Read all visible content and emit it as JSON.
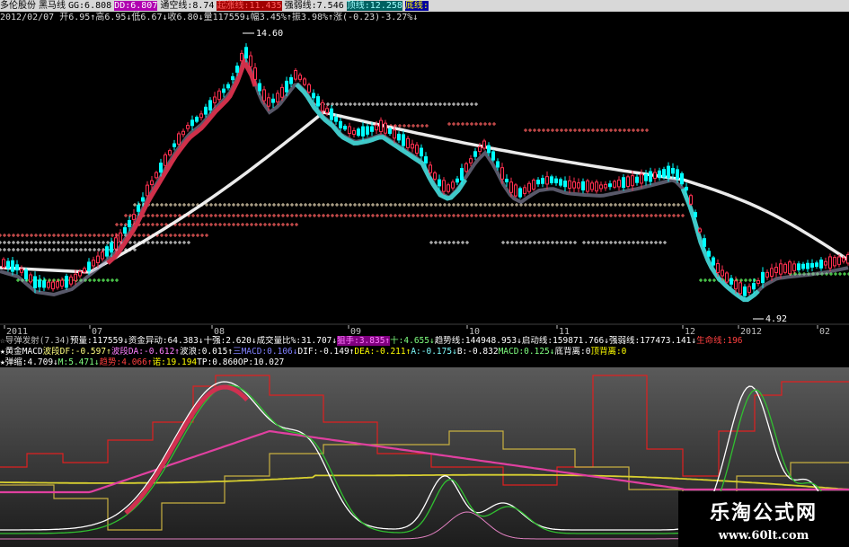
{
  "header": {
    "row1": [
      {
        "text": "多伦股份",
        "color": "#000000"
      },
      {
        "text": "黑马线",
        "color": "#000000"
      },
      {
        "text": "GG:6.808",
        "color": "#000000"
      },
      {
        "text": "DD:6.807",
        "color": "#ffffff",
        "bg": "#b000b0"
      },
      {
        "text": "通空线:8.74",
        "color": "#000000"
      },
      {
        "text": "起涨线:11.435",
        "color": "#ff6060",
        "bg": "#a00000"
      },
      {
        "text": "强弱线:7.546",
        "color": "#000000"
      },
      {
        "text": "顶线:12.258",
        "color": "#a0ffff",
        "bg": "#006060"
      },
      {
        "text": "底线:",
        "color": "#ffff00",
        "bg": "#0000a0"
      }
    ],
    "row2": "2012/02/07 开6.95↑高6.95↓低6.67↓收6.80↓量117559↓幅3.45%↑振3.98%↑涨(-0.23)-3.27%↓"
  },
  "price_labels": {
    "high": "14.60",
    "low": "4.92"
  },
  "x_axis": [
    {
      "label": "2011",
      "color": "#c0c0c0"
    },
    {
      "label": "07",
      "color": "#c0c0c0"
    },
    {
      "label": "08",
      "color": "#c0c0c0"
    },
    {
      "label": "09",
      "color": "#c0c0c0"
    },
    {
      "label": "10",
      "color": "#c0c0c0"
    },
    {
      "label": "11",
      "color": "#c0c0c0"
    },
    {
      "label": "12",
      "color": "#c0c0c0"
    },
    {
      "label": "2012",
      "color": "#c0c0c0"
    },
    {
      "label": "02",
      "color": "#c0c0c0"
    }
  ],
  "indicators": {
    "line1": [
      {
        "text": "☆导弹发射(7.34)",
        "color": "#c0c0c0"
      },
      {
        "text": "预量:117559↓",
        "color": "#ffffff"
      },
      {
        "text": "资金异动:64.383↓",
        "color": "#ffffff"
      },
      {
        "text": "十强:2.620↓",
        "color": "#ffffff"
      },
      {
        "text": "成交量比%:31.707↓",
        "color": "#ffffff"
      },
      {
        "text": "狙手:3.835↑",
        "color": "#ff80ff",
        "bg": "#800080"
      },
      {
        "text": "十:4.655↓",
        "color": "#80ff80"
      },
      {
        "text": "趋势线:144948.953↓",
        "color": "#ffffff"
      },
      {
        "text": "启动线:159871.766↓",
        "color": "#ffffff"
      },
      {
        "text": "强弱线:177473.141↓",
        "color": "#ffffff"
      },
      {
        "text": "生命线:196",
        "color": "#ff4040"
      }
    ],
    "line2": [
      {
        "text": "★黄金MACD",
        "color": "#ffffff"
      },
      {
        "text": "波段DF:-0.597↑",
        "color": "#ffff80"
      },
      {
        "text": "波段DA:-0.612↑",
        "color": "#ff80ff"
      },
      {
        "text": "波浪:0.015↑",
        "color": "#ffffff"
      },
      {
        "text": "三MACD:0.106↓",
        "color": "#8080ff"
      },
      {
        "text": "DIF:-0.149↑",
        "color": "#ffffff"
      },
      {
        "text": "DEA:-0.211↑",
        "color": "#ffff00"
      },
      {
        "text": "A:-0.175↓",
        "color": "#80ffff"
      },
      {
        "text": "B:-0.832",
        "color": "#ffffff"
      },
      {
        "text": "MACD:0.125↓",
        "color": "#80ff80"
      },
      {
        "text": "底背离:0",
        "color": "#ffffff"
      },
      {
        "text": "顶背离:0",
        "color": "#ffff00"
      }
    ],
    "line3": [
      {
        "text": "★弹",
        "color": "#ffffff"
      },
      {
        "text": "缩:4.709↓",
        "color": "#ffffff"
      },
      {
        "text": "M:5.471↓",
        "color": "#80ff80"
      },
      {
        "text": "趋势:4.066↑",
        "color": "#ff4040"
      },
      {
        "text": "诺:19.194",
        "color": "#ffff00"
      },
      {
        "text": "TP:0.860",
        "color": "#ffffff"
      },
      {
        "text": "OP:10.027",
        "color": "#ffffff"
      }
    ]
  },
  "watermark": {
    "title": "乐淘公式网",
    "url": "www.60lt.com"
  },
  "colors": {
    "up": "#ff3050",
    "down": "#00ffff",
    "background": "#000000"
  }
}
